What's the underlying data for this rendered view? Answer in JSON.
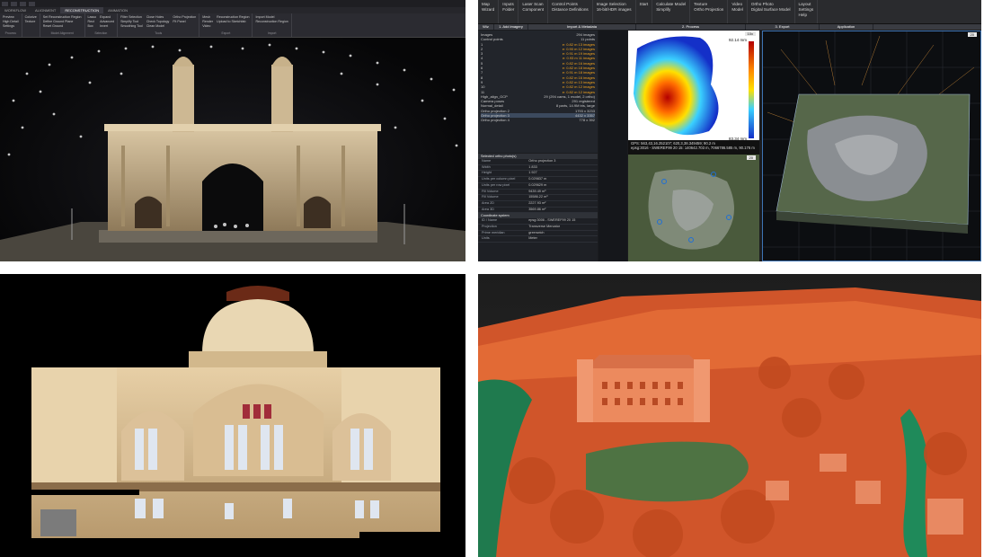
{
  "panel_gateway": {
    "title_tabs": [
      "WORKFLOW",
      "ALIGNMENT",
      "RECONSTRUCTION",
      "ANIMATION"
    ],
    "active_tab": "RECONSTRUCTION",
    "left_items": [
      "Preview",
      "High Detail",
      "Settings"
    ],
    "groups": [
      {
        "label": "Process",
        "items": [
          "Colorize",
          "Texture"
        ]
      },
      {
        "label": "Model Alignment",
        "items": [
          "Set Reconstruction Region",
          "Define Ground Plane",
          "Reset Ground"
        ]
      },
      {
        "label": "Selection",
        "items": [
          "Lasso",
          "Rect",
          "Box",
          "Expand",
          "Advanced",
          "Invert"
        ]
      },
      {
        "label": "Tools",
        "items": [
          "Filter Selection",
          "Simplify Tool",
          "Smoothing Tool",
          "Close Holes",
          "Check Topology",
          "Clean Model",
          "Ortho Projection",
          "Fit Panel"
        ]
      },
      {
        "label": "Export",
        "items": [
          "Mesh",
          "Render",
          "Video",
          "Reconstruction Region",
          "Upload to Sketchfab"
        ]
      },
      {
        "label": "Import",
        "items": [
          "Import Model",
          "Reconstruction Region"
        ]
      }
    ]
  },
  "panel_zephyr": {
    "ribbon": [
      {
        "items": [
          "Map",
          "Wizard"
        ]
      },
      {
        "items": [
          "Inputs",
          "Folder"
        ]
      },
      {
        "items": [
          "Laser Scan",
          "Component"
        ]
      },
      {
        "items": [
          "Control Points",
          "Distance Definitions"
        ]
      },
      {
        "items": [
          "Image Selection",
          "16-bit/HDR images"
        ]
      },
      {
        "items": [
          "Start"
        ]
      },
      {
        "items": [
          "Calculate Model",
          "Simplify"
        ]
      },
      {
        "items": [
          "Texture",
          "Ortho Projection"
        ]
      },
      {
        "items": [
          "Video",
          "Model"
        ]
      },
      {
        "items": [
          "Ortho Photo",
          "Digital Surface Model"
        ]
      },
      {
        "items": [
          "Layout",
          "Settings",
          "Help"
        ]
      }
    ],
    "tabs": [
      "Wiz",
      "1. Add imagery",
      "Import & Metadata",
      "2. Process",
      "3. Export",
      "Application"
    ],
    "tree_header": {
      "name": "Images",
      "value": "294 images"
    },
    "tree_rows": [
      {
        "name": "Control points",
        "value": "11 points"
      },
      {
        "name": "1",
        "value": "e: 0.82 m  13 images"
      },
      {
        "name": "2",
        "value": "e: 0.90 m  12 images"
      },
      {
        "name": "3",
        "value": "e: 0.91 m  19 images"
      },
      {
        "name": "4",
        "value": "e: 0.93 m  11 images"
      },
      {
        "name": "5",
        "value": "e: 0.82 m  16 images"
      },
      {
        "name": "6",
        "value": "e: 0.82 m  18 images"
      },
      {
        "name": "7",
        "value": "e: 0.91 m  18 images"
      },
      {
        "name": "8",
        "value": "e: 0.82 m  16 images"
      },
      {
        "name": "9",
        "value": "e: 0.82 m  13 images"
      },
      {
        "name": "10",
        "value": "e: 0.82 m  12 images"
      },
      {
        "name": "11",
        "value": "e: 0.82 m  12 images"
      },
      {
        "name": "High_align_GCP",
        "value": "29 (294 cams, 1 model, 2 ortho)"
      },
      {
        "name": "Camera poses",
        "value": "291 registered"
      },
      {
        "name": "Normal_detail",
        "value": "8 parts, 14.9M tris, large"
      },
      {
        "name": "Ortho projection 2",
        "value": "1793 x 3233"
      },
      {
        "name": "Ortho projection 3",
        "value": "4432 x 3357"
      },
      {
        "name": "Ortho projection 4",
        "value": "778 x 392"
      }
    ],
    "props_title": "Selected ortho photo(s)",
    "props": [
      {
        "k": "Name",
        "v": "Ortho projection 3"
      },
      {
        "k": "Width",
        "v": "1 833"
      },
      {
        "k": "Height",
        "v": "1 927"
      },
      {
        "k": "Units per column pixel",
        "v": "0.029837 m"
      },
      {
        "k": "Units per row pixel",
        "v": "0.029629 m"
      },
      {
        "k": "Fill Volume",
        "v": "9439.49 m³"
      },
      {
        "k": "Fill Volume",
        "v": "15586.22 m³"
      },
      {
        "k": "Area 2D",
        "v": "2227.93 m²"
      },
      {
        "k": "Area 3D",
        "v": "3569.86 m²"
      }
    ],
    "coord_title": "Coordinate system",
    "coord": [
      {
        "k": "ID / Name",
        "v": "epsg:3006 - SWEREF99 20 15"
      },
      {
        "k": "Projection",
        "v": "Transverse Mercator"
      },
      {
        "k": "Prime meridian",
        "v": "greenwich"
      },
      {
        "k": "Units",
        "v": "Meter"
      }
    ],
    "heatmap": {
      "max_label": "92.14 mm",
      "min_label": "83.34 mm",
      "zoom": "10x"
    },
    "status": [
      "GPS: 563,43,16.252107; 620,3,38.349459; 90.2 m",
      "epsg:3016 - SWEREF99 20 15: 140642.703 m, 7066786.585 m, 90.176 m"
    ],
    "badges": [
      "20",
      "20"
    ],
    "colors": {
      "accent": "#3d73b3",
      "heat_hot": "#b40000",
      "heat_cold": "#1430c8"
    }
  }
}
